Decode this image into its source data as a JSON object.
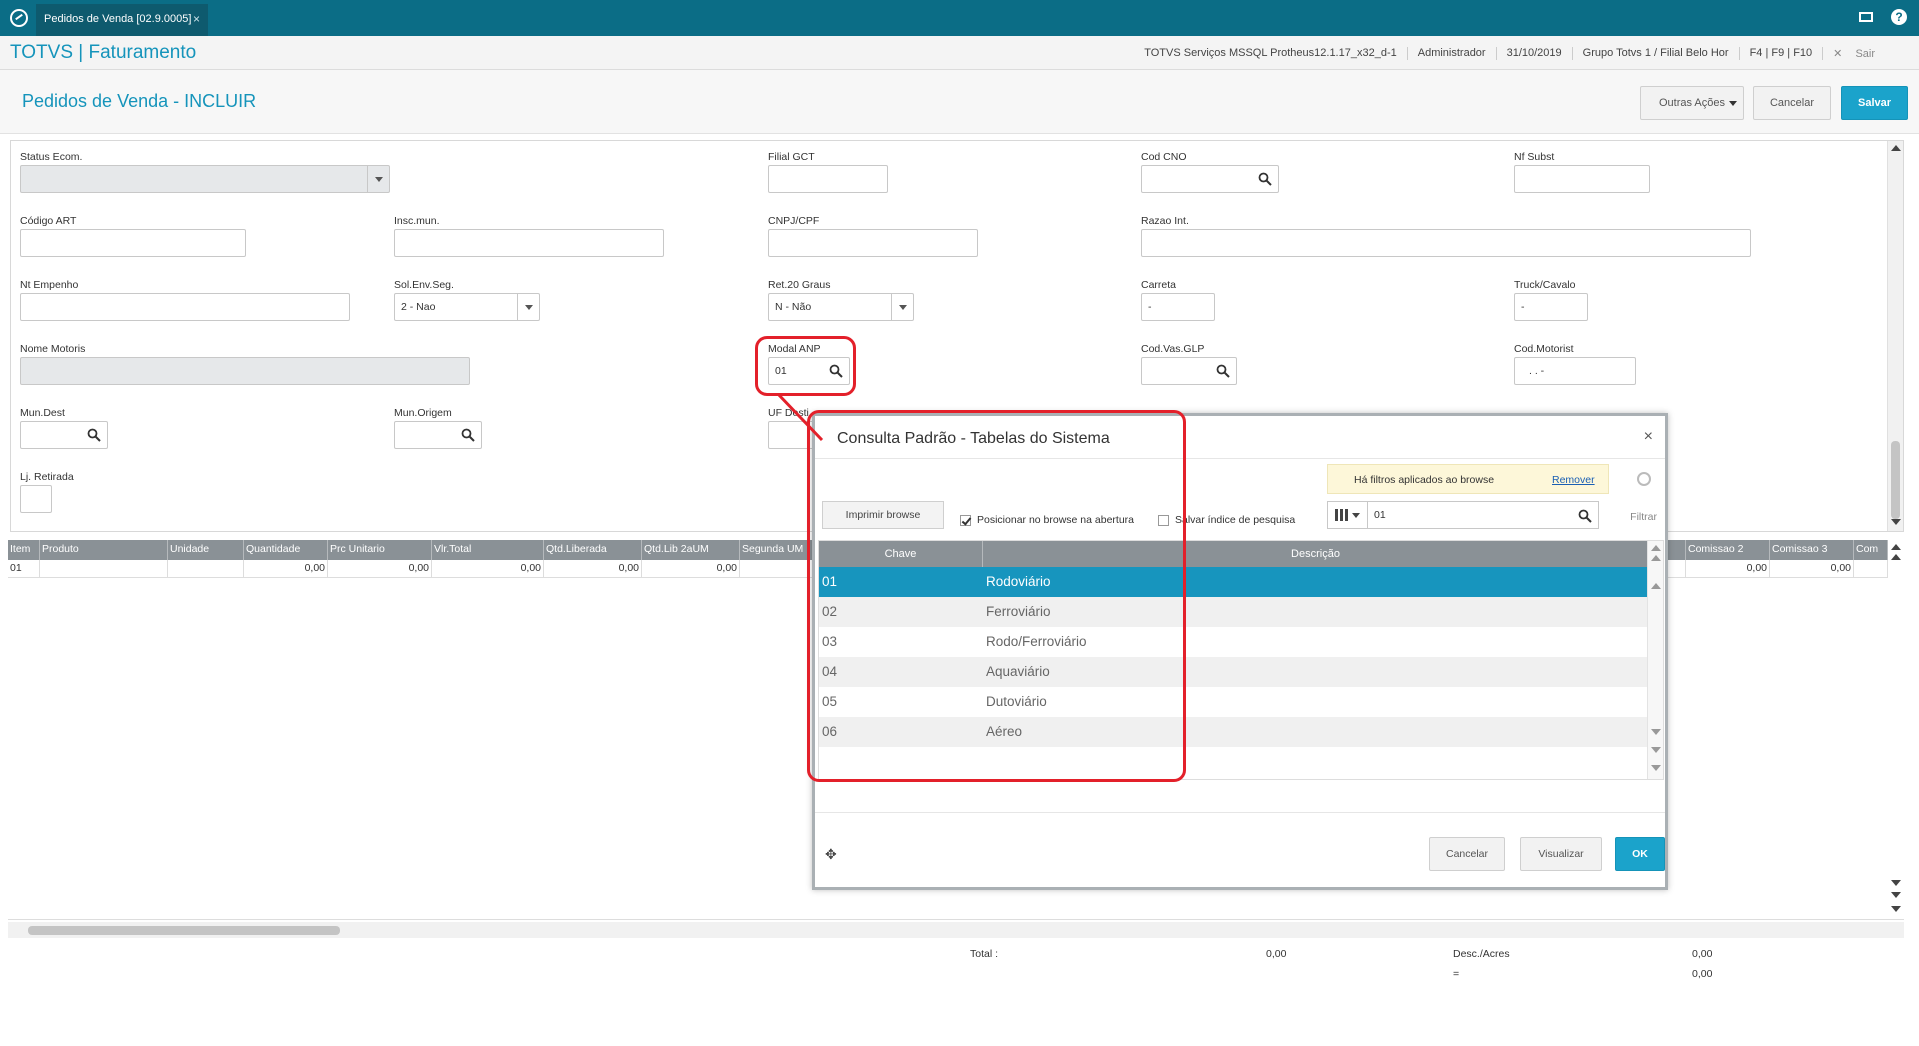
{
  "topbar": {
    "tab_label": "Pedidos de Venda [02.9.0005]",
    "tab_close": "×"
  },
  "app": {
    "title": "TOTVS | Faturamento",
    "info": [
      "TOTVS Serviços MSSQL Protheus12.1.17_x32_d-1",
      "Administrador",
      "31/10/2019",
      "Grupo Totvs 1 / Filial Belo Hor",
      "F4 | F9 | F10"
    ],
    "exit_label": "Sair"
  },
  "page": {
    "title": "Pedidos de Venda - INCLUIR",
    "buttons": {
      "outras": "Outras Ações",
      "cancelar": "Cancelar",
      "salvar": "Salvar"
    }
  },
  "form": {
    "status_ecom": {
      "label": "Status Ecom.",
      "value": ""
    },
    "filial_gct": {
      "label": "Filial GCT",
      "value": ""
    },
    "cod_cno": {
      "label": "Cod CNO",
      "value": ""
    },
    "nf_subst": {
      "label": "Nf Subst",
      "value": ""
    },
    "codigo_art": {
      "label": "Código ART",
      "value": ""
    },
    "insc_mun": {
      "label": "Insc.mun.",
      "value": ""
    },
    "cnpj_cpf": {
      "label": "CNPJ/CPF",
      "value": ""
    },
    "razao_int": {
      "label": "Razao Int.",
      "value": ""
    },
    "nt_empenho": {
      "label": "Nt Empenho",
      "value": ""
    },
    "sol_env_seg": {
      "label": "Sol.Env.Seg.",
      "value": "2 - Nao"
    },
    "ret_20_graus": {
      "label": "Ret.20 Graus",
      "value": "N - Não"
    },
    "carreta": {
      "label": "Carreta",
      "value": "-"
    },
    "truck_cavalo": {
      "label": "Truck/Cavalo",
      "value": "-"
    },
    "nome_motoris": {
      "label": "Nome Motoris",
      "value": ""
    },
    "modal_anp": {
      "label": "Modal ANP",
      "value": "01"
    },
    "cod_vas_glp": {
      "label": "Cod.Vas.GLP",
      "value": ""
    },
    "cod_motorist": {
      "label": "Cod.Motorist",
      "value": ". . -"
    },
    "mun_dest": {
      "label": "Mun.Dest",
      "value": ""
    },
    "mun_origem": {
      "label": "Mun.Origem",
      "value": ""
    },
    "uf_dest": {
      "label": "UF Desti",
      "value": ""
    },
    "lj_retirada": {
      "label": "Lj. Retirada",
      "value": ""
    }
  },
  "grid": {
    "columns": [
      "Item",
      "Produto",
      "Unidade",
      "Quantidade",
      "Prc Unitario",
      "Vlr.Total",
      "Qtd.Liberada",
      "Qtd.Lib 2aUM",
      "Segunda UM",
      "Comissao 2",
      "Comissao 3",
      "Com"
    ],
    "row": [
      "01",
      "",
      "",
      "0,00",
      "0,00",
      "0,00",
      "0,00",
      "0,00",
      "",
      "0,00",
      "0,00",
      ""
    ]
  },
  "totals": {
    "total_label": "Total :",
    "total_value": "0,00",
    "desc_label": "Desc./Acres",
    "desc_value": "0,00",
    "eq_label": "=",
    "eq_value": "0,00"
  },
  "dialog": {
    "title": "Consulta Padrão - Tabelas do Sistema",
    "close": "×",
    "filter_text": "Há filtros aplicados ao browse",
    "filter_remove": "Remover",
    "print_button": "Imprimir browse",
    "check_position": "Posicionar no browse na abertura",
    "check_save_index": "Salvar índice de pesquisa",
    "search_value": "01",
    "filtrar": "Filtrar",
    "headers": {
      "chave": "Chave",
      "descricao": "Descrição"
    },
    "rows": [
      {
        "chave": "01",
        "descricao": "Rodoviário"
      },
      {
        "chave": "02",
        "descricao": "Ferroviário"
      },
      {
        "chave": "03",
        "descricao": "Rodo/Ferroviário"
      },
      {
        "chave": "04",
        "descricao": "Aquaviário"
      },
      {
        "chave": "05",
        "descricao": "Dutoviário"
      },
      {
        "chave": "06",
        "descricao": "Aéreo"
      }
    ],
    "buttons": {
      "cancelar": "Cancelar",
      "visualizar": "Visualizar",
      "ok": "OK"
    }
  },
  "colors": {
    "accent": "#1ba3cb",
    "topbar": "#0b6d86",
    "annotation": "#e3202a"
  }
}
